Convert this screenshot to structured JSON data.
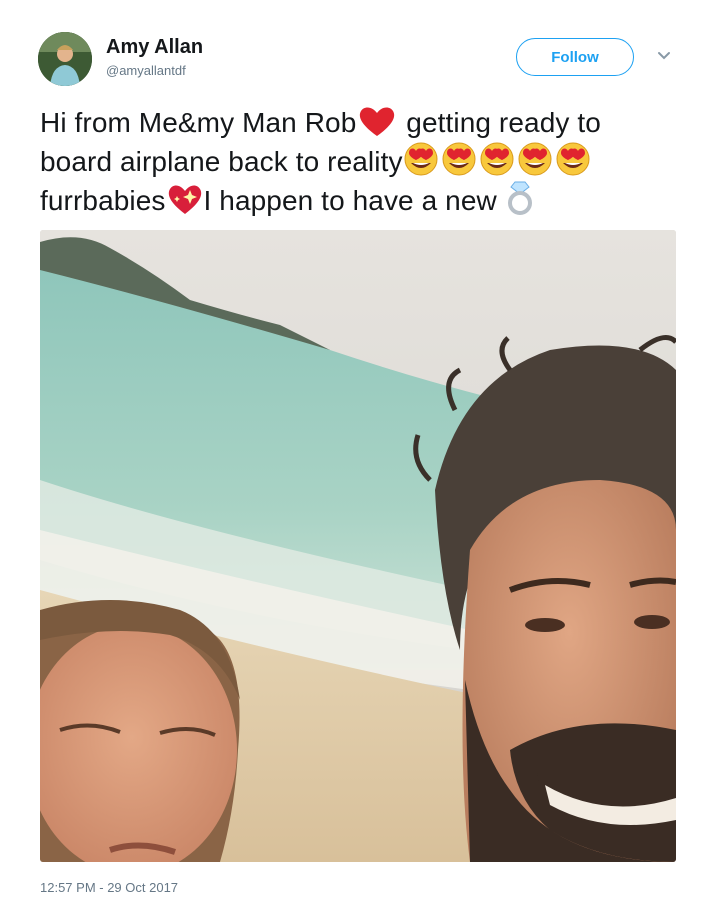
{
  "author": {
    "name": "Amy Allan",
    "handle": "@amyallantdf",
    "avatar_icon": "profile-photo"
  },
  "follow_button": {
    "label": "Follow",
    "icon": "chevron-down-icon"
  },
  "tweet": {
    "lines": [
      {
        "parts": [
          "Hi from Me&my Man Rob",
          "getting ready to"
        ]
      },
      {
        "parts": [
          "board airplane back to reality"
        ]
      },
      {
        "parts": [
          "furrbabies",
          "I happen to have a new"
        ]
      }
    ],
    "emojis": [
      "red-heart",
      "heart-eyes-x5",
      "sparkling-heart",
      "ring"
    ]
  },
  "photo": {
    "description_icon": "beach-selfie-photo"
  },
  "timestamp": "12:57 PM - 29 Oct 2017",
  "colors": {
    "accent": "#1da1f2",
    "secondary_text": "#657786",
    "text": "#14171a"
  }
}
